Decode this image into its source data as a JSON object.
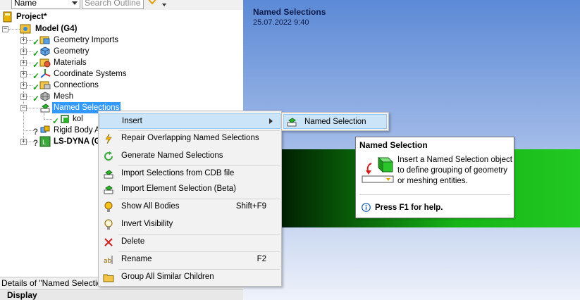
{
  "toolbar": {
    "name_combo": "Name",
    "search_placeholder": "Search Outline"
  },
  "tree": {
    "project": "Project*",
    "model": "Model (G4)",
    "geometry_imports": "Geometry Imports",
    "geometry": "Geometry",
    "materials": "Materials",
    "coordinate_systems": "Coordinate Systems",
    "connections": "Connections",
    "mesh": "Mesh",
    "named_selections": "Named Selections",
    "kol": "kol",
    "rigid_body": "Rigid Body Ac",
    "lsdyna": "LS-DYNA (G"
  },
  "details": {
    "title": "Details of \"Named Selectio",
    "display": "Display"
  },
  "viewport": {
    "title": "Named Selections",
    "date": "25.07.2022 9:40"
  },
  "context_menu": {
    "insert": "Insert",
    "repair": "Repair Overlapping Named Selections",
    "generate": "Generate Named Selections",
    "import_cdb": "Import Selections from CDB file",
    "import_element": "Import Element Selection (Beta)",
    "show_all": "Show All Bodies",
    "show_all_key": "Shift+F9",
    "invert": "Invert Visibility",
    "delete": "Delete",
    "rename": "Rename",
    "rename_key": "F2",
    "group": "Group All Similar Children"
  },
  "submenu": {
    "named_selection": "Named Selection"
  },
  "tooltip": {
    "title": "Named Selection",
    "body": "Insert a Named Selection object to define grouping of geometry or meshing entities.",
    "help": "Press F1 for help."
  },
  "colors": {
    "menu_highlight": "#cce4f7",
    "tree_selection": "#3399ff",
    "viewport_top": "#5c8ad6",
    "body_green": "#22c922"
  }
}
